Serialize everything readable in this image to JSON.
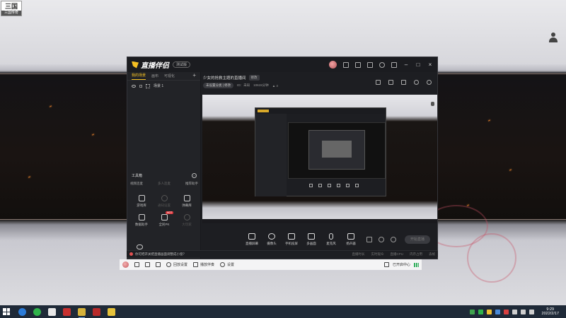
{
  "desktop": {
    "corner_badge": {
      "title": "三国",
      "subtitle": "三国传奇"
    }
  },
  "app": {
    "name": "直播伴侣",
    "version": "测试版",
    "left_tabs": [
      "我的场景",
      "画布",
      "可视化"
    ],
    "scene_name": "场景 1",
    "tools_title": "工具箱",
    "tools_sub": [
      "视频连麦",
      "多人连麦",
      "推荐助手"
    ],
    "tools": [
      {
        "label": "游戏库",
        "dim": false,
        "hot": ""
      },
      {
        "label": "通知设置",
        "dim": true,
        "hot": ""
      },
      {
        "label": "弹幕库",
        "dim": false,
        "hot": ""
      },
      {
        "label": "数据助手",
        "dim": false,
        "hot": ""
      },
      {
        "label": "全民PK",
        "dim": false,
        "hot": "HOT"
      },
      {
        "label": "大玩家",
        "dim": true,
        "hot": ""
      }
    ],
    "bottom_tool": "上一场回放",
    "room_title": "少女的抢救主题的直播间",
    "room_tag": "修改",
    "category": "未设置分类 | 修改",
    "meta_id": "ID：未知",
    "meta_time": "10615分钟",
    "meta_viewers": "4",
    "controls": [
      "直播屏幕",
      "摄像头",
      "手机投屏",
      "多画面",
      "麦克风",
      "扬声器"
    ],
    "start_button": "开始直播",
    "status_tip": "你可把开关把直播画面调整成小窗？",
    "status_stats": [
      "直播时长",
      "实时观众",
      "直播CPU",
      "内存占用",
      "丢帧"
    ]
  },
  "livebar": {
    "items": [
      "回放设置",
      "播放伴奏",
      "设置"
    ],
    "right_label": "已开启中心"
  },
  "taskbar": {
    "time": "9:29",
    "date": "2022/2/17"
  }
}
